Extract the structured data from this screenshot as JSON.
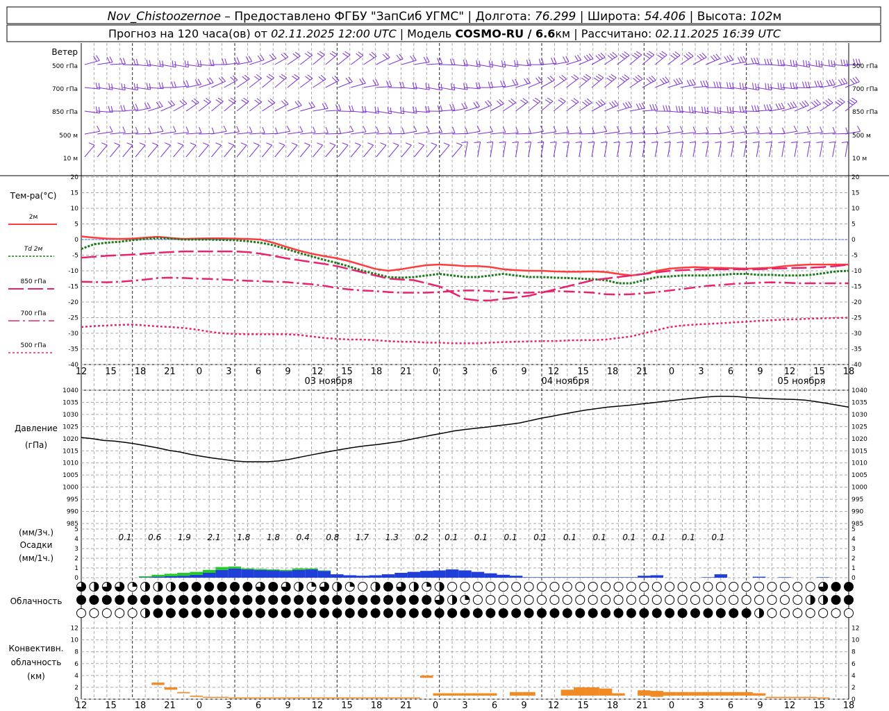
{
  "header": {
    "station": "Nov_Chistoozernoe",
    "provider": " – Предоставлено ФГБУ \"ЗапСиб УГМС\" | Долгота: ",
    "lon": "76.299",
    "lat_label": " | Широта: ",
    "lat": "54.406",
    "alt_label": " | Высота: ",
    "alt": "102",
    "alt_unit": "м",
    "line2_a": "Прогноз на 120 часа(ов) от ",
    "init": "02.11.2025 12:00 UTC",
    "line2_b": "  | Модель ",
    "model": "COSMO-RU / 6.6",
    "model_unit": "км",
    "line2_c": " | Рассчитано: ",
    "calc": "02.11.2025 16:39 UTC"
  },
  "wind_panel": {
    "title": "Ветер",
    "levels": [
      "500 гПа",
      "700 гПа",
      "850 гПа",
      "500 м",
      "10  м"
    ],
    "barb_color": "#7b2fd6"
  },
  "temp_panel": {
    "title": "Тем-ра(°C)",
    "legend": [
      "2м",
      "Td  2м",
      "850 гПа",
      "700 гПа",
      "500 гПа"
    ],
    "y_ticks": [
      20,
      15,
      10,
      5,
      0,
      -5,
      -10,
      -15,
      -20,
      -25,
      -30,
      -35,
      -40
    ]
  },
  "pressure_panel": {
    "title": "Давление",
    "unit": "(гПа)",
    "y_ticks": [
      1040,
      1035,
      1030,
      1025,
      1020,
      1015,
      1010,
      1005,
      1000,
      995,
      990,
      985
    ]
  },
  "precip_panel": {
    "unit_3h": "(мм/3ч.)",
    "title": "Осадки",
    "unit_1h": "(мм/1ч.)",
    "y_ticks": [
      5,
      4,
      3,
      2,
      1,
      0
    ],
    "totals_3h": [
      "0.1",
      "0.6",
      "1.9",
      "2.1",
      "1.8",
      "1.8",
      "0.4",
      "0.8",
      "1.7",
      "1.3",
      "0.2",
      "0.1",
      "0.1",
      "0.1",
      "0.1",
      "0.1",
      "0.1",
      "0.1",
      "0.1",
      "0.1",
      "0.1"
    ]
  },
  "cloud_panel": {
    "title": "Облачность"
  },
  "conv_panel": {
    "title1": "Конвективн.",
    "title2": "облачность",
    "unit": "(км)",
    "y_ticks": [
      12,
      10,
      8,
      6,
      4,
      2,
      0
    ]
  },
  "x_axis": {
    "hour_labels": [
      "12",
      "15",
      "18",
      "21",
      "0",
      "3",
      "6",
      "9",
      "12",
      "15",
      "18",
      "21",
      "0",
      "3",
      "6",
      "9",
      "12",
      "15",
      "18",
      "21",
      "0",
      "3",
      "6",
      "9",
      "12",
      "15",
      "18"
    ],
    "day_labels": [
      "03 ноября",
      "04 ноября",
      "05 ноября"
    ]
  },
  "chart_data": [
    {
      "type": "line",
      "title": "Тем-ра(°C)",
      "x_hours": [
        0,
        3,
        6,
        9,
        12,
        15,
        18,
        21,
        24,
        27,
        30,
        33,
        36,
        39,
        42,
        45,
        48,
        51,
        54,
        57,
        60,
        63,
        66,
        69,
        72,
        75,
        78,
        81,
        84,
        87,
        90,
        93,
        96,
        99,
        102,
        105,
        108,
        111,
        114,
        117,
        120,
        123,
        126,
        129,
        132,
        135,
        138,
        141,
        144,
        147,
        150,
        153,
        156,
        159,
        162,
        165,
        168,
        171,
        174,
        177,
        180
      ],
      "ylim": [
        -40,
        20
      ],
      "series": [
        {
          "name": "2м",
          "color": "#ff3b3b",
          "values": [
            1,
            0.6,
            0.3,
            0.2,
            0.3,
            0.6,
            0.9,
            0.5,
            0.2,
            0.3,
            0.4,
            0.4,
            0.3,
            0.2,
            0,
            -1,
            -2.3,
            -3.5,
            -4.5,
            -5.3,
            -6,
            -7,
            -8.2,
            -9.4,
            -10,
            -9.5,
            -8.8,
            -8.2,
            -8,
            -8.2,
            -8.5,
            -8.5,
            -8.8,
            -9.5,
            -9.8,
            -10,
            -10,
            -10.2,
            -10.3,
            -10.3,
            -10.2,
            -10.4,
            -11,
            -11.5,
            -11,
            -10,
            -9.3,
            -9,
            -8.8,
            -9,
            -9.1,
            -9.2,
            -9.3,
            -9.2,
            -9,
            -8.5,
            -8.2,
            -8,
            -8,
            -8,
            -8
          ]
        },
        {
          "name": "Td  2м",
          "color": "#1a7a1a",
          "values": [
            -3,
            -1.5,
            -1,
            -0.7,
            -0.2,
            0.2,
            0.5,
            0.3,
            0,
            0,
            0,
            -0.1,
            -0.2,
            -0.5,
            -1,
            -1.8,
            -3,
            -4.2,
            -5.4,
            -6.5,
            -7.5,
            -8.7,
            -10,
            -11,
            -12,
            -12.2,
            -12,
            -11.5,
            -11,
            -11.5,
            -12,
            -12,
            -11.5,
            -11,
            -11.5,
            -12,
            -12,
            -12.2,
            -12.3,
            -12.5,
            -12.7,
            -13,
            -14,
            -14,
            -13,
            -12,
            -11.8,
            -11.5,
            -11.5,
            -11.5,
            -11.3,
            -11,
            -11,
            -11.3,
            -11.3,
            -11.5,
            -11.5,
            -11.3,
            -10.8,
            -10.2,
            -10
          ]
        },
        {
          "name": "850 гПа",
          "color": "#e8226f",
          "dash": "22 6",
          "values": [
            -5.8,
            -5.5,
            -5.2,
            -5,
            -4.8,
            -4.5,
            -4.2,
            -4,
            -3.8,
            -3.8,
            -3.8,
            -3.8,
            -3.8,
            -4,
            -4.5,
            -5.2,
            -6,
            -6.6,
            -7.2,
            -7.8,
            -8.5,
            -9.5,
            -10.5,
            -11.5,
            -12.5,
            -12.8,
            -13,
            -14,
            -15,
            -17,
            -19,
            -19.5,
            -19.5,
            -19,
            -18.5,
            -18,
            -17,
            -16,
            -15,
            -14,
            -13,
            -12.5,
            -12,
            -11.5,
            -11,
            -10.5,
            -10,
            -9.8,
            -9.6,
            -9.5,
            -9.5,
            -9.5,
            -9.5,
            -9.5,
            -9.3,
            -9.2,
            -9.1,
            -9,
            -8.8,
            -8.5,
            -8
          ]
        },
        {
          "name": "700 гПа",
          "color": "#e8226f",
          "dash": "16 5 3 5",
          "values": [
            -13.5,
            -13.6,
            -13.7,
            -13.5,
            -13.2,
            -12.8,
            -12.3,
            -12.2,
            -12.3,
            -12.5,
            -12.6,
            -12.8,
            -13,
            -13.2,
            -13.3,
            -13.5,
            -13.6,
            -14,
            -14.3,
            -14.8,
            -15.5,
            -16,
            -16.3,
            -16.5,
            -16.8,
            -17,
            -17,
            -17,
            -16.8,
            -16.5,
            -16.3,
            -16.3,
            -16.5,
            -16.8,
            -17,
            -17,
            -16.8,
            -16.5,
            -16.6,
            -16.8,
            -17,
            -17.5,
            -17.6,
            -17.5,
            -17.2,
            -16.8,
            -16.3,
            -15.8,
            -15.3,
            -14.8,
            -14.5,
            -14.2,
            -14,
            -13.8,
            -13.7,
            -13.8,
            -14,
            -14,
            -14,
            -14,
            -14
          ]
        },
        {
          "name": "500 гПа",
          "color": "#e8226f",
          "dash": "3 3",
          "values": [
            -28,
            -27.7,
            -27.5,
            -27.3,
            -27.2,
            -27.5,
            -27.8,
            -28,
            -28.3,
            -28.8,
            -29.5,
            -30,
            -30.2,
            -30.3,
            -30.3,
            -30.3,
            -30.3,
            -30.5,
            -31,
            -31.5,
            -31.8,
            -32,
            -32,
            -32.2,
            -32.5,
            -32.7,
            -32.7,
            -33,
            -33,
            -33.2,
            -33.2,
            -33.2,
            -33,
            -32.8,
            -32.7,
            -32.6,
            -32.5,
            -32.5,
            -32.3,
            -32.2,
            -32.2,
            -32,
            -31.5,
            -31,
            -30,
            -29,
            -28,
            -27.5,
            -27.2,
            -27,
            -26.8,
            -26.5,
            -26.3,
            -26,
            -25.8,
            -25.6,
            -25.5,
            -25.3,
            -25.2,
            -25.1,
            -25
          ]
        }
      ]
    },
    {
      "type": "line",
      "title": "Давление",
      "ylabel": "(гПа)",
      "ylim": [
        985,
        1040
      ],
      "x_hours": [
        0,
        3,
        6,
        9,
        12,
        15,
        18,
        21,
        24,
        27,
        30,
        33,
        36,
        39,
        42,
        45,
        48,
        51,
        54,
        57,
        60,
        63,
        66,
        69,
        72,
        75,
        78,
        81,
        84,
        87,
        90,
        93,
        96,
        99,
        102,
        105,
        108,
        111,
        114,
        117,
        120,
        123,
        126,
        129,
        132,
        135,
        138,
        141,
        144,
        147,
        150,
        153,
        156,
        159,
        162,
        165,
        168,
        171,
        174,
        177,
        180
      ],
      "series": [
        {
          "name": "Давление",
          "color": "#000000",
          "values": [
            1020.5,
            1020,
            1019.3,
            1019,
            1018.5,
            1017.8,
            1017,
            1016.2,
            1015.2,
            1014.5,
            1013.5,
            1012.7,
            1012,
            1011.4,
            1010.8,
            1010.5,
            1010.5,
            1010.5,
            1010.8,
            1011.5,
            1012.4,
            1013.3,
            1014.2,
            1015,
            1015.8,
            1016.5,
            1017.1,
            1017.6,
            1018.2,
            1018.8,
            1019.7,
            1020.6,
            1021.5,
            1022.3,
            1023.2,
            1023.8,
            1024.3,
            1024.8,
            1025.4,
            1025.9,
            1026.5,
            1027.5,
            1028.5,
            1029.3,
            1030.2,
            1031,
            1031.8,
            1032.4,
            1033,
            1033.4,
            1033.8,
            1034.3,
            1034.8,
            1035.3,
            1035.8,
            1036.3,
            1036.8,
            1037.2,
            1037.5,
            1037.5,
            1037.3,
            1036.9,
            1036.7,
            1036.5,
            1036.3,
            1036.2,
            1035.9,
            1035.3,
            1034.6,
            1033.8,
            1033
          ]
        }
      ]
    },
    {
      "type": "bar",
      "title": "Осадки",
      "ylabel": "(мм/1ч.)",
      "ylim": [
        0,
        5
      ],
      "x_hours": [
        0,
        3,
        6,
        9,
        12,
        15,
        18,
        21,
        24,
        27,
        30,
        33,
        36,
        39,
        42,
        45,
        48,
        51,
        54,
        57,
        60,
        63,
        66,
        69,
        72,
        75,
        78,
        81,
        84,
        87,
        90,
        93,
        96,
        99,
        102,
        105,
        108,
        111,
        114,
        117,
        120,
        123,
        126,
        129,
        132,
        135,
        138,
        141,
        144,
        147,
        150,
        153,
        156,
        159,
        162,
        165,
        168,
        171,
        174,
        177,
        180
      ],
      "series": [
        {
          "name": "snow",
          "color": "#1f3fd8",
          "values": [
            0,
            0,
            0,
            0,
            0,
            0.05,
            0.1,
            0.15,
            0.2,
            0.3,
            0.5,
            0.8,
            0.95,
            0.85,
            0.8,
            0.75,
            0.7,
            0.8,
            0.85,
            0.7,
            0.35,
            0.25,
            0.2,
            0.25,
            0.35,
            0.5,
            0.6,
            0.7,
            0.75,
            0.85,
            0.75,
            0.6,
            0.45,
            0.3,
            0.2,
            0.05,
            0.05,
            0.05,
            0.05,
            0.05,
            0.05,
            0.05,
            0.05,
            0.05,
            0.2,
            0.25,
            0,
            0,
            0,
            0.05,
            0.35,
            0,
            0,
            0.1,
            0,
            0.05,
            0,
            0,
            0.05,
            0,
            0
          ]
        },
        {
          "name": "rain",
          "color": "#22cc22",
          "values": [
            0,
            0,
            0,
            0,
            0,
            0.1,
            0.2,
            0.25,
            0.3,
            0.3,
            0.3,
            0.3,
            0.2,
            0.1,
            0.1,
            0.1,
            0.1,
            0.15,
            0.1,
            0.05,
            0,
            0,
            0,
            0,
            0,
            0,
            0,
            0,
            0,
            0,
            0,
            0,
            0,
            0,
            0,
            0,
            0,
            0,
            0,
            0,
            0,
            0,
            0,
            0,
            0,
            0,
            0,
            0,
            0,
            0,
            0,
            0,
            0,
            0,
            0,
            0,
            0,
            0,
            0,
            0,
            0
          ]
        }
      ]
    },
    {
      "type": "bar",
      "title": "Конвективн. облачность",
      "ylabel": "(км)",
      "ylim": [
        0,
        13
      ],
      "x_hours": [
        0,
        3,
        6,
        9,
        12,
        15,
        18,
        21,
        24,
        27,
        30,
        33,
        36,
        39,
        42,
        45,
        48,
        51,
        54,
        57,
        60,
        63,
        66,
        69,
        72,
        75,
        78,
        81,
        84,
        87,
        90,
        93,
        96,
        99,
        102,
        105,
        108,
        111,
        114,
        117,
        120,
        123,
        126,
        129,
        132,
        135,
        138,
        141,
        144,
        147,
        150,
        153,
        156,
        159,
        162,
        165,
        168,
        171,
        174,
        177,
        180
      ],
      "series": [
        {
          "name": "bottom",
          "color": "#f08a24",
          "values": [
            0,
            0,
            0,
            0,
            0,
            0,
            2.4,
            1.6,
            1,
            0.4,
            0.3,
            0.3,
            0.2,
            0.2,
            0.2,
            0.2,
            0.2,
            0.2,
            0.2,
            0.2,
            0.2,
            0.2,
            0.2,
            0.2,
            0.2,
            0.2,
            0.2,
            3.6,
            0.6,
            0.6,
            0.6,
            0.6,
            0.6,
            0,
            0.6,
            0.6,
            0,
            0,
            0.6,
            0.6,
            0.6,
            0.6,
            0.6,
            0.6,
            0.6,
            0.4,
            0.6,
            0.6,
            0.6,
            0.6,
            0.6,
            0.6,
            0.6,
            0.6,
            0.2,
            0.2,
            0.2,
            0.2,
            0.2,
            0,
            0
          ]
        },
        {
          "name": "top",
          "color": "#f08a24",
          "values": [
            0,
            0,
            0,
            0,
            0,
            0,
            2.8,
            2,
            1.2,
            0.6,
            0.4,
            0.4,
            0.3,
            0.3,
            0.3,
            0.3,
            0.3,
            0.3,
            0.3,
            0.3,
            0.3,
            0.3,
            0.3,
            0.3,
            0.3,
            0.3,
            0.3,
            4,
            1,
            1,
            1,
            1,
            1,
            0,
            1.2,
            1.2,
            0,
            0,
            1.6,
            2,
            2,
            1.8,
            1,
            0,
            1.5,
            1.4,
            1.2,
            1.2,
            1.2,
            1.2,
            1.2,
            1.2,
            1.2,
            1,
            0.4,
            0.4,
            0.4,
            0.4,
            0.3,
            0,
            0
          ]
        }
      ]
    }
  ]
}
